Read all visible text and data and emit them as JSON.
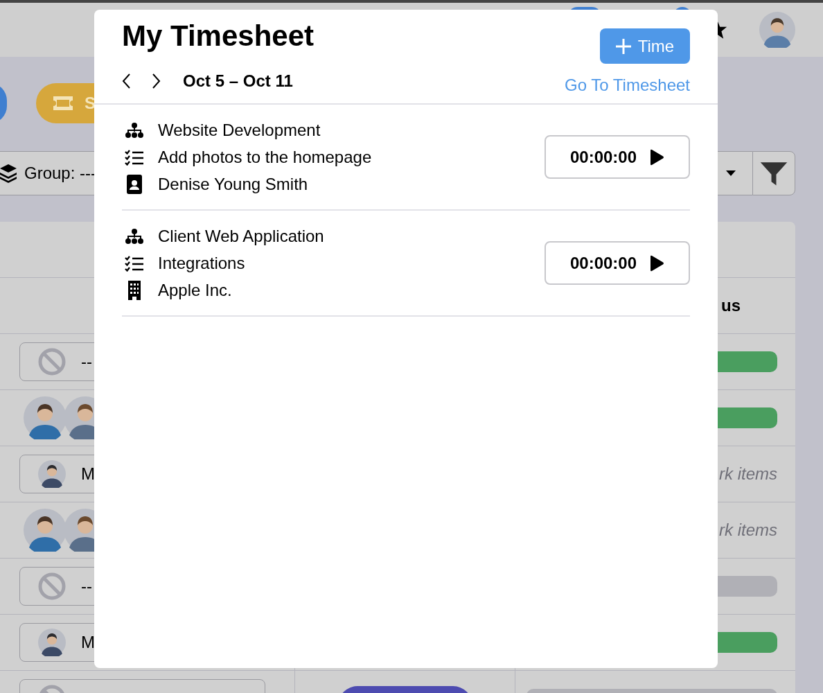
{
  "background": {
    "buttons": [
      {
        "kind": "icon-only",
        "color": "#3f7fd0"
      },
      {
        "kind": "labelled",
        "color": "#d6a73c",
        "label": "S"
      }
    ],
    "group_label": "Group: ---",
    "table": {
      "status_header": "us",
      "rows": [
        {
          "assignee": {
            "kind": "none",
            "text": "--"
          },
          "status": {
            "kind": "bar",
            "color": "#4a9e5f"
          }
        },
        {
          "assignee": {
            "kind": "pair"
          },
          "status": {
            "kind": "bar",
            "color": "#4a9e5f"
          }
        },
        {
          "assignee": {
            "kind": "single",
            "text": "M"
          },
          "status": {
            "kind": "text",
            "text": "rk items"
          }
        },
        {
          "assignee": {
            "kind": "pair"
          },
          "status": {
            "kind": "text",
            "text": "rk items"
          }
        },
        {
          "assignee": {
            "kind": "none",
            "text": "--"
          },
          "status": {
            "kind": "bar",
            "color": "#b0b0b6"
          }
        },
        {
          "assignee": {
            "kind": "single",
            "text": "M"
          },
          "status": {
            "kind": "bar",
            "color": "#4a9e5f"
          }
        },
        {
          "assignee": {
            "kind": "none"
          },
          "middle": {
            "kind": "button",
            "color": "#4d4bb0"
          },
          "status": {
            "kind": "bar",
            "color": "#b0b0b6"
          }
        }
      ]
    }
  },
  "modal": {
    "title": "My Timesheet",
    "add_button": {
      "label": "Time"
    },
    "date_range": "Oct 5 – Oct 11",
    "link": "Go To Timesheet",
    "entries": [
      {
        "lines": [
          {
            "kind": "project",
            "text": "Website Development"
          },
          {
            "kind": "task",
            "text": "Add photos to the homepage"
          },
          {
            "kind": "contact",
            "text": "Denise Young Smith"
          }
        ],
        "timer": "00:00:00"
      },
      {
        "lines": [
          {
            "kind": "project",
            "text": "Client Web Application"
          },
          {
            "kind": "task",
            "text": "Integrations"
          },
          {
            "kind": "company",
            "text": "Apple Inc."
          }
        ],
        "timer": "00:00:00"
      }
    ]
  }
}
